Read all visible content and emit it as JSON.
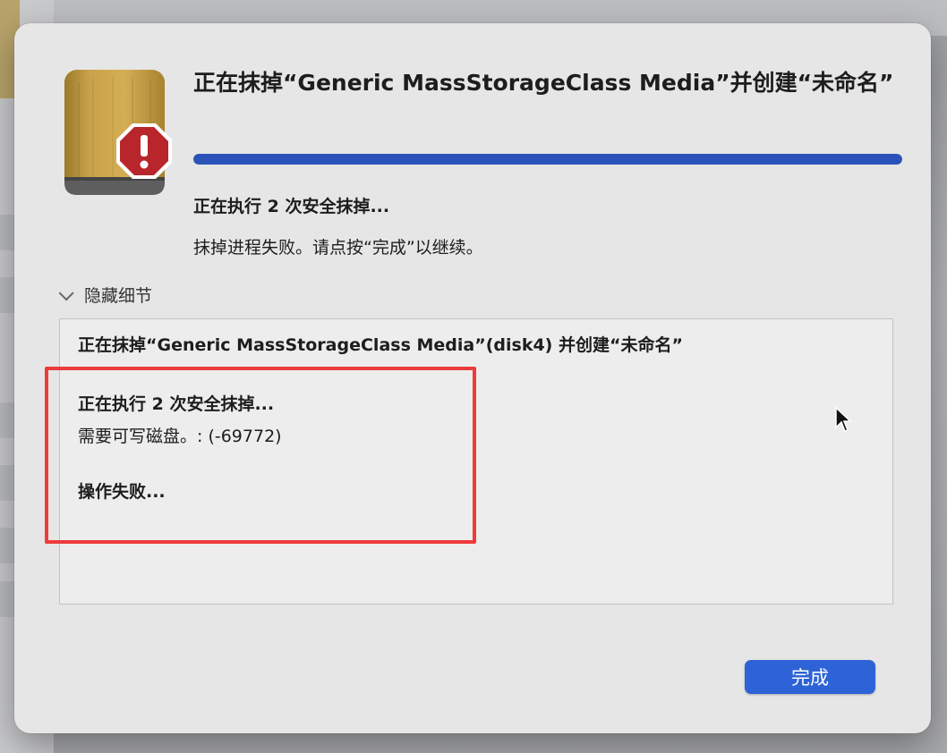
{
  "dialog": {
    "title": "正在抹掉“Generic MassStorageClass Media”并创建“未命名”",
    "progress": 1.0,
    "status_title": "正在执行 2 次安全抹掉...",
    "status_subtitle": "抹掉进程失败。请点按“完成”以继续。",
    "details_toggle_label": "隐藏细节",
    "log": {
      "line1": "正在抹掉“Generic MassStorageClass Media”(disk4) 并创建“未命名”",
      "line2": "正在执行 2 次安全抹掉...",
      "line3": "需要可写磁盘。: (-69772)",
      "line4": "操作失败..."
    },
    "done_button": "完成"
  },
  "colors": {
    "accent": "#2d63d6",
    "progress": "#2a52b8",
    "highlight": "#ee3b3b",
    "warning": "#b8262b"
  },
  "icons": {
    "disk": "external-disk-icon",
    "warning": "warning-octagon-icon",
    "toggle": "chevron-down-icon",
    "pointer": "mouse-pointer-icon"
  }
}
